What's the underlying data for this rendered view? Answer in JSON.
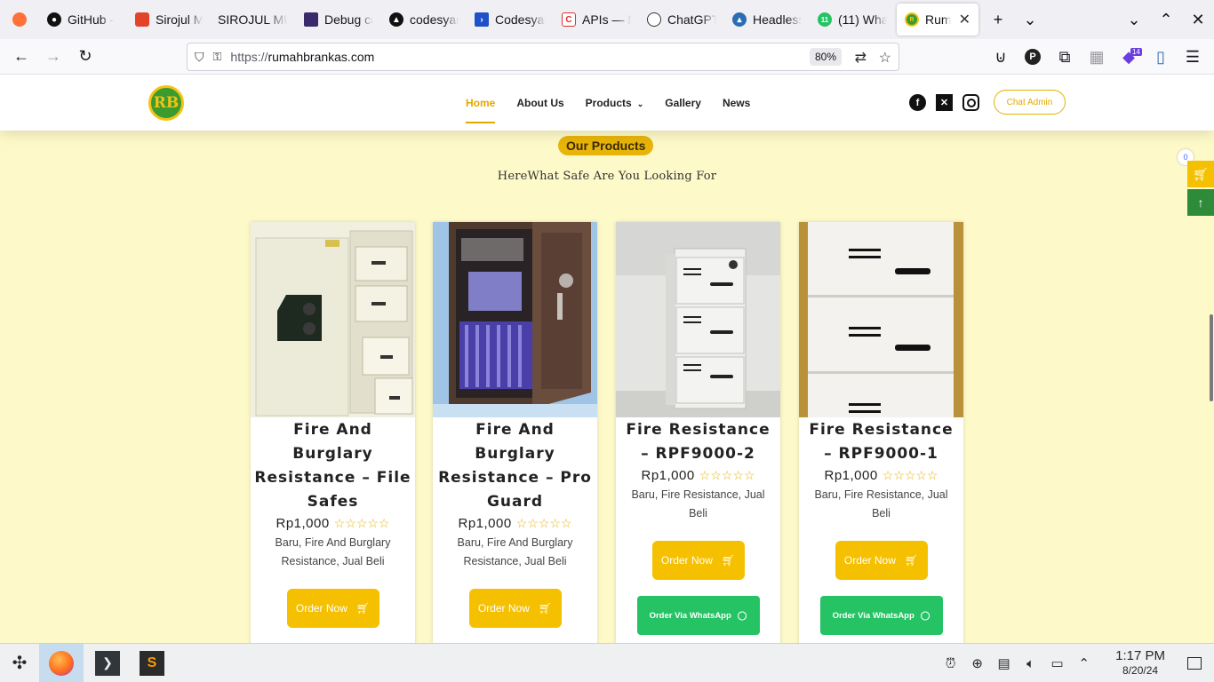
{
  "browser": {
    "tabs": [
      {
        "label": "",
        "icon": "firefox-icon",
        "color": "#ff7139"
      },
      {
        "label": "GitHub -",
        "icon": "github-icon",
        "color": "#111111"
      },
      {
        "label": "Sirojul M",
        "icon": "gitlab-icon",
        "color": "#e24329"
      },
      {
        "label": "SIROJUL MU",
        "icon": "blank-icon",
        "color": "#cccccc"
      },
      {
        "label": "Debug co",
        "icon": "debug-icon",
        "color": "#3b2a6b"
      },
      {
        "label": "codesyar",
        "icon": "codesyar-icon",
        "color": "#111111"
      },
      {
        "label": "Codesyar",
        "icon": "terminal-icon",
        "color": "#1e50c8"
      },
      {
        "label": "APIs — M",
        "icon": "apis-icon",
        "color": "#e03030"
      },
      {
        "label": "ChatGPT",
        "icon": "chatgpt-icon",
        "color": "#333333"
      },
      {
        "label": "Headless",
        "icon": "headless-icon",
        "color": "#2b6db0"
      },
      {
        "label": "(11) Wha",
        "icon": "whatsapp-icon",
        "color": "#25c364"
      },
      {
        "label": "Rumal",
        "icon": "rumah-icon",
        "color": "#3a9b2f",
        "active": true
      }
    ],
    "url_scheme": "https://",
    "url_host": "rumahbrankas.com",
    "zoom": "80%",
    "ext_badge": "14"
  },
  "site": {
    "logo_text": "RB",
    "nav": [
      {
        "label": "Home",
        "active": true
      },
      {
        "label": "About Us"
      },
      {
        "label": "Products",
        "dropdown": true
      },
      {
        "label": "Gallery"
      },
      {
        "label": "News"
      }
    ],
    "social": [
      "facebook-icon",
      "x-icon",
      "instagram-icon"
    ],
    "chat_button": "Chat Admin",
    "section_badge": "Our Products",
    "section_subtitle": "HereWhat Safe Are You Looking For",
    "cart_count": "0",
    "order_label": "Order Now",
    "whatsapp_label": "Order Via WhatsApp",
    "products": [
      {
        "title": "Fire And Burglary Resistance – File Safes",
        "price": "Rp1,000",
        "categories": "Baru, Fire And Burglary Resistance, Jual Beli",
        "rating": 0
      },
      {
        "title": "Fire And Burglary Resistance – Pro Guard",
        "price": "Rp1,000",
        "categories": "Baru, Fire And Burglary Resistance, Jual Beli",
        "rating": 0
      },
      {
        "title": "Fire Resistance – RPF9000-2",
        "price": "Rp1,000",
        "categories": "Baru, Fire Resistance, Jual Beli",
        "rating": 0
      },
      {
        "title": "Fire Resistance – RPF9000-1",
        "price": "Rp1,000",
        "categories": "Baru, Fire Resistance, Jual Beli",
        "rating": 0
      }
    ]
  },
  "taskbar": {
    "time": "1:17 PM",
    "date": "8/20/24"
  }
}
